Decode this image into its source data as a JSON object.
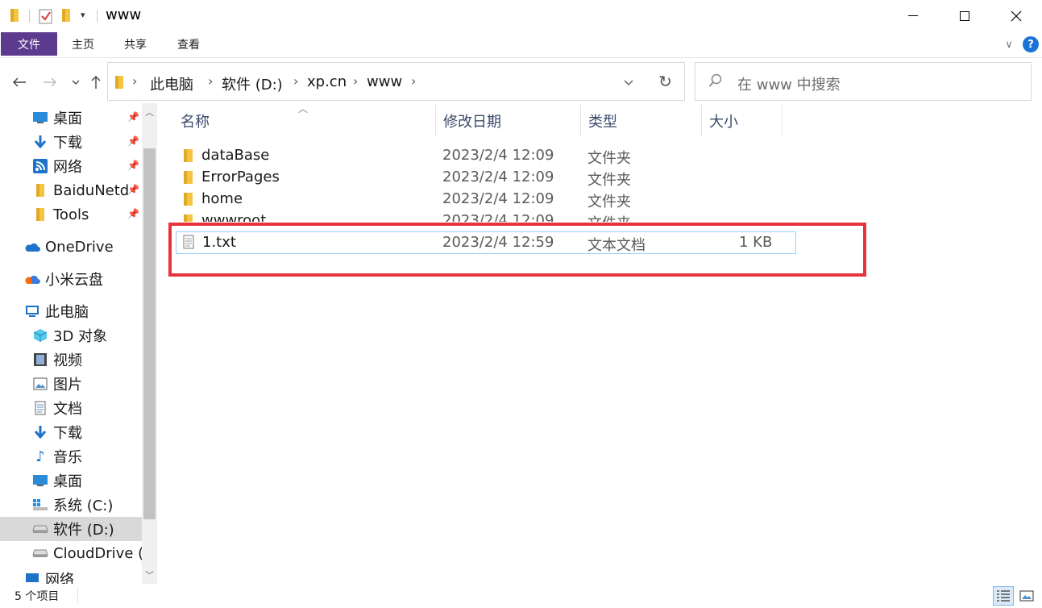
{
  "window": {
    "title": "www"
  },
  "ribbon": {
    "tabs": [
      "文件",
      "主页",
      "共享",
      "查看"
    ]
  },
  "address": {
    "segments": [
      "此电脑",
      "软件 (D:)",
      "xp.cn",
      "www"
    ]
  },
  "search": {
    "placeholder": "在 www 中搜索"
  },
  "nav": {
    "quick_access": [
      {
        "label": "桌面",
        "icon": "desktop-icon",
        "pinned": true
      },
      {
        "label": "下载",
        "icon": "download-icon",
        "pinned": true
      },
      {
        "label": "网络",
        "icon": "network-icon",
        "pinned": true
      },
      {
        "label": "BaiduNetd",
        "icon": "folder-icon",
        "pinned": true
      },
      {
        "label": "Tools",
        "icon": "folder-icon",
        "pinned": true
      }
    ],
    "onedrive": "OneDrive",
    "xiaomi": "小米云盘",
    "this_pc": "此电脑",
    "pc_items": [
      {
        "label": "3D 对象",
        "icon": "cube-icon"
      },
      {
        "label": "视频",
        "icon": "video-icon"
      },
      {
        "label": "图片",
        "icon": "picture-icon"
      },
      {
        "label": "文档",
        "icon": "document-icon"
      },
      {
        "label": "下载",
        "icon": "download-icon"
      },
      {
        "label": "音乐",
        "icon": "music-icon"
      },
      {
        "label": "桌面",
        "icon": "desktop-icon"
      },
      {
        "label": "系统 (C:)",
        "icon": "windows-drive-icon"
      },
      {
        "label": "软件 (D:)",
        "icon": "drive-icon",
        "selected": true
      },
      {
        "label": "CloudDrive (",
        "icon": "drive-icon"
      },
      {
        "label": "网络",
        "icon": "network-icon"
      }
    ]
  },
  "columns": {
    "name": "名称",
    "modified": "修改日期",
    "type": "类型",
    "size": "大小"
  },
  "files": [
    {
      "name": "dataBase",
      "modified": "2023/2/4 12:09",
      "type": "文件夹",
      "size": "",
      "kind": "folder"
    },
    {
      "name": "ErrorPages",
      "modified": "2023/2/4 12:09",
      "type": "文件夹",
      "size": "",
      "kind": "folder"
    },
    {
      "name": "home",
      "modified": "2023/2/4 12:09",
      "type": "文件夹",
      "size": "",
      "kind": "folder"
    },
    {
      "name": "wwwroot",
      "modified": "2023/2/4 12:09",
      "type": "文件夹",
      "size": "",
      "kind": "folder"
    },
    {
      "name": "1.txt",
      "modified": "2023/2/4 12:59",
      "type": "文本文档",
      "size": "1 KB",
      "kind": "text",
      "selected": true
    }
  ],
  "status": {
    "count": "5 个项目"
  },
  "colors": {
    "file_tab": "#5c3b8f",
    "highlight": "#e8323c",
    "folder": "#f5c542",
    "selection_border": "#99d1ff"
  }
}
